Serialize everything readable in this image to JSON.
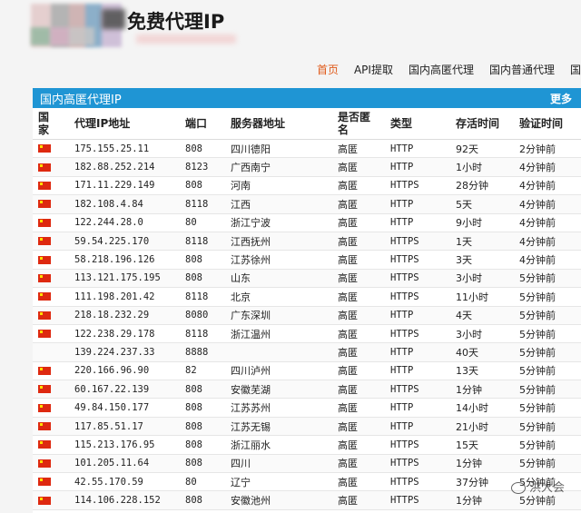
{
  "site": {
    "title": "免费代理IP"
  },
  "nav": [
    {
      "label": "首页",
      "active": true
    },
    {
      "label": "API提取"
    },
    {
      "label": "国内高匿代理"
    },
    {
      "label": "国内普通代理"
    },
    {
      "label": "国"
    }
  ],
  "panel": {
    "title": "国内高匿代理IP",
    "more": "更多"
  },
  "columns": [
    "国家",
    "代理IP地址",
    "端口",
    "服务器地址",
    "是否匿名",
    "类型",
    "存活时间",
    "验证时间"
  ],
  "rows": [
    {
      "flag": true,
      "ip": "175.155.25.11",
      "port": "808",
      "loc": "四川德阳",
      "anon": "高匿",
      "type": "HTTP",
      "alive": "92天",
      "verified": "2分钟前"
    },
    {
      "flag": true,
      "ip": "182.88.252.214",
      "port": "8123",
      "loc": "广西南宁",
      "anon": "高匿",
      "type": "HTTP",
      "alive": "1小时",
      "verified": "4分钟前"
    },
    {
      "flag": true,
      "ip": "171.11.229.149",
      "port": "808",
      "loc": "河南",
      "anon": "高匿",
      "type": "HTTPS",
      "alive": "28分钟",
      "verified": "4分钟前"
    },
    {
      "flag": true,
      "ip": "182.108.4.84",
      "port": "8118",
      "loc": "江西",
      "anon": "高匿",
      "type": "HTTP",
      "alive": "5天",
      "verified": "4分钟前"
    },
    {
      "flag": true,
      "ip": "122.244.28.0",
      "port": "80",
      "loc": "浙江宁波",
      "anon": "高匿",
      "type": "HTTP",
      "alive": "9小时",
      "verified": "4分钟前"
    },
    {
      "flag": true,
      "ip": "59.54.225.170",
      "port": "8118",
      "loc": "江西抚州",
      "anon": "高匿",
      "type": "HTTPS",
      "alive": "1天",
      "verified": "4分钟前"
    },
    {
      "flag": true,
      "ip": "58.218.196.126",
      "port": "808",
      "loc": "江苏徐州",
      "anon": "高匿",
      "type": "HTTPS",
      "alive": "3天",
      "verified": "4分钟前"
    },
    {
      "flag": true,
      "ip": "113.121.175.195",
      "port": "808",
      "loc": "山东",
      "anon": "高匿",
      "type": "HTTPS",
      "alive": "3小时",
      "verified": "5分钟前"
    },
    {
      "flag": true,
      "ip": "111.198.201.42",
      "port": "8118",
      "loc": "北京",
      "anon": "高匿",
      "type": "HTTPS",
      "alive": "11小时",
      "verified": "5分钟前"
    },
    {
      "flag": true,
      "ip": "218.18.232.29",
      "port": "8080",
      "loc": "广东深圳",
      "anon": "高匿",
      "type": "HTTP",
      "alive": "4天",
      "verified": "5分钟前"
    },
    {
      "flag": true,
      "ip": "122.238.29.178",
      "port": "8118",
      "loc": "浙江温州",
      "anon": "高匿",
      "type": "HTTPS",
      "alive": "3小时",
      "verified": "5分钟前"
    },
    {
      "flag": false,
      "ip": "139.224.237.33",
      "port": "8888",
      "loc": "",
      "anon": "高匿",
      "type": "HTTP",
      "alive": "40天",
      "verified": "5分钟前"
    },
    {
      "flag": true,
      "ip": "220.166.96.90",
      "port": "82",
      "loc": "四川泸州",
      "anon": "高匿",
      "type": "HTTP",
      "alive": "13天",
      "verified": "5分钟前"
    },
    {
      "flag": true,
      "ip": "60.167.22.139",
      "port": "808",
      "loc": "安徽芜湖",
      "anon": "高匿",
      "type": "HTTPS",
      "alive": "1分钟",
      "verified": "5分钟前"
    },
    {
      "flag": true,
      "ip": "49.84.150.177",
      "port": "808",
      "loc": "江苏苏州",
      "anon": "高匿",
      "type": "HTTP",
      "alive": "14小时",
      "verified": "5分钟前"
    },
    {
      "flag": true,
      "ip": "117.85.51.17",
      "port": "808",
      "loc": "江苏无锡",
      "anon": "高匿",
      "type": "HTTP",
      "alive": "21小时",
      "verified": "5分钟前"
    },
    {
      "flag": true,
      "ip": "115.213.176.95",
      "port": "808",
      "loc": "浙江丽水",
      "anon": "高匿",
      "type": "HTTPS",
      "alive": "15天",
      "verified": "5分钟前"
    },
    {
      "flag": true,
      "ip": "101.205.11.64",
      "port": "808",
      "loc": "四川",
      "anon": "高匿",
      "type": "HTTPS",
      "alive": "1分钟",
      "verified": "5分钟前"
    },
    {
      "flag": true,
      "ip": "42.55.170.59",
      "port": "80",
      "loc": "辽宁",
      "anon": "高匿",
      "type": "HTTPS",
      "alive": "37分钟",
      "verified": "5分钟前"
    },
    {
      "flag": true,
      "ip": "114.106.228.152",
      "port": "808",
      "loc": "安徽池州",
      "anon": "高匿",
      "type": "HTTPS",
      "alive": "1分钟",
      "verified": "5分钟前"
    }
  ],
  "watermark": "洪大会",
  "colors": {
    "accent": "#1f95d4",
    "active_nav": "#e05a1a"
  }
}
